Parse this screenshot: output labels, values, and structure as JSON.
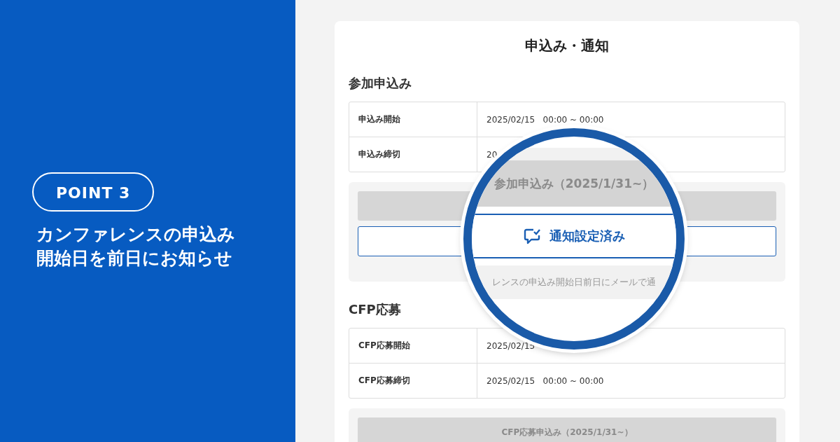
{
  "badge": "POINT 3",
  "headline": [
    "カンファレンスの申込み",
    "開始日を前日にお知らせ"
  ],
  "card": {
    "title": "申込み・通知",
    "sections": [
      {
        "heading": "参加申込み",
        "rows": [
          {
            "label": "申込み開始",
            "value": "2025/02/15   00:00 ~ 00:00"
          },
          {
            "label": "申込み締切",
            "value": "20"
          }
        ],
        "action": {
          "has_button": true
        }
      },
      {
        "heading": "CFP応募",
        "rows": [
          {
            "label": "CFP応募開始",
            "value": "2025/02/15"
          },
          {
            "label": "CFP応募締切",
            "value": "2025/02/15   00:00 ~ 00:00"
          }
        ],
        "action": {
          "label": "CFP応募申込み（2025/1/31~）",
          "has_button": false
        }
      }
    ]
  },
  "magnifier": {
    "title": "参加申込み（2025/1/31~）",
    "button": "通知設定済み",
    "note": "レンスの申込み開始日前日にメールで通"
  }
}
